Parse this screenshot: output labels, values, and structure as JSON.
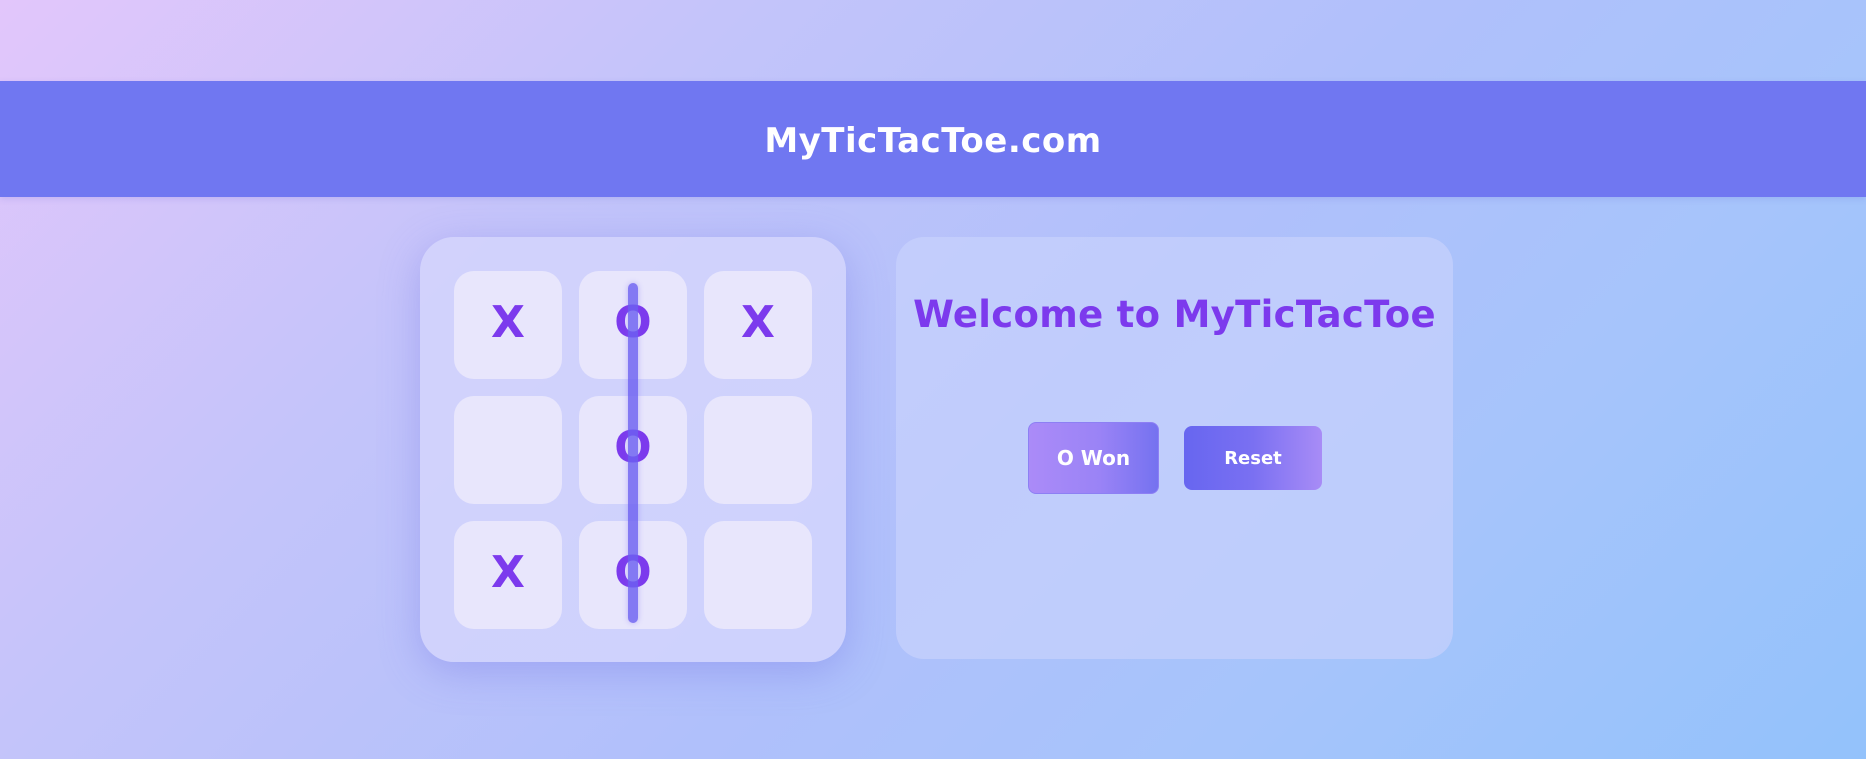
{
  "header": {
    "title": "MyTicTacToe.com",
    "background": "#7077f1"
  },
  "board": {
    "cells": [
      "X",
      "O",
      "X",
      "",
      "O",
      "",
      "X",
      "O",
      ""
    ],
    "winning_line": {
      "type": "column",
      "index": 1,
      "color": "#6d60f0"
    },
    "mark_color": "#7c3aed"
  },
  "panel": {
    "welcome": "Welcome to MyTicTacToe",
    "status_label": "O Won",
    "reset_label": "Reset"
  }
}
